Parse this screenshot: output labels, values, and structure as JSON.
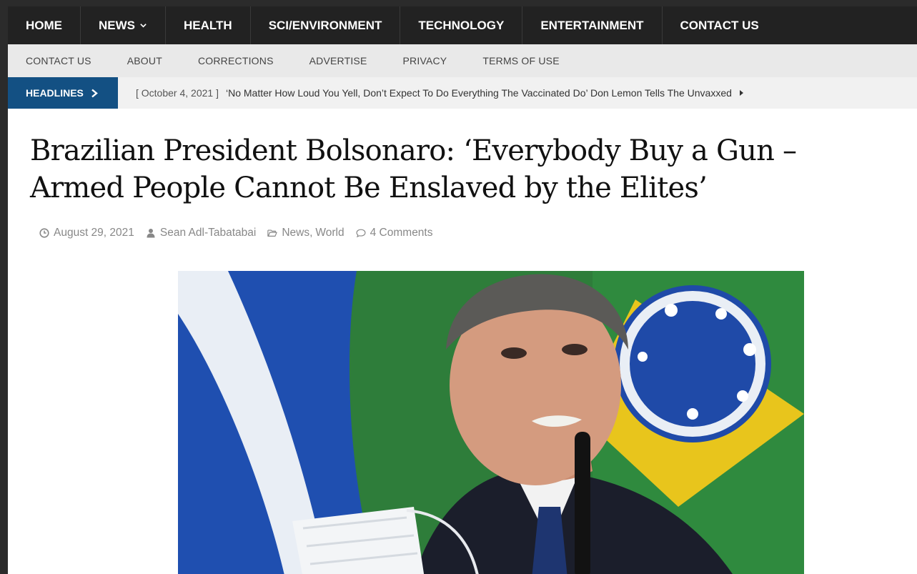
{
  "topnav": {
    "items": [
      {
        "label": "HOME"
      },
      {
        "label": "NEWS"
      },
      {
        "label": "HEALTH"
      },
      {
        "label": "SCI/ENVIRONMENT"
      },
      {
        "label": "TECHNOLOGY"
      },
      {
        "label": "ENTERTAINMENT"
      },
      {
        "label": "CONTACT US"
      }
    ]
  },
  "subnav": {
    "items": [
      {
        "label": "CONTACT US"
      },
      {
        "label": "ABOUT"
      },
      {
        "label": "CORRECTIONS"
      },
      {
        "label": "ADVERTISE"
      },
      {
        "label": "PRIVACY"
      },
      {
        "label": "TERMS OF USE"
      }
    ]
  },
  "ticker": {
    "label": "HEADLINES",
    "date": "[ October 4, 2021 ]",
    "headline": "‘No Matter How Loud You Yell, Don’t Expect To Do Everything The Vaccinated Do’ Don Lemon Tells The Unvaxxed"
  },
  "article": {
    "title": "Brazilian President Bolsonaro: ‘Everybody Buy a Gun – Armed People Cannot Be Enslaved by the Elites’",
    "meta": {
      "date": "August 29, 2021",
      "author": "Sean Adl-Tabatabai",
      "category_news": "News",
      "category_sep": ",",
      "category_world": "World",
      "comments": "4 Comments"
    }
  },
  "colors": {
    "topnav_bg": "#222222",
    "subnav_bg": "#e9e9e9",
    "headlines_bg": "#135083",
    "ticker_bg": "#f1f1f1"
  },
  "icons": {
    "news_dropdown": "chevron-down-icon",
    "headlines_arrow": "chevron-right-icon",
    "ticker_next": "caret-right-icon",
    "date": "clock-icon",
    "author": "user-icon",
    "category": "folder-icon",
    "comments": "comment-icon"
  }
}
